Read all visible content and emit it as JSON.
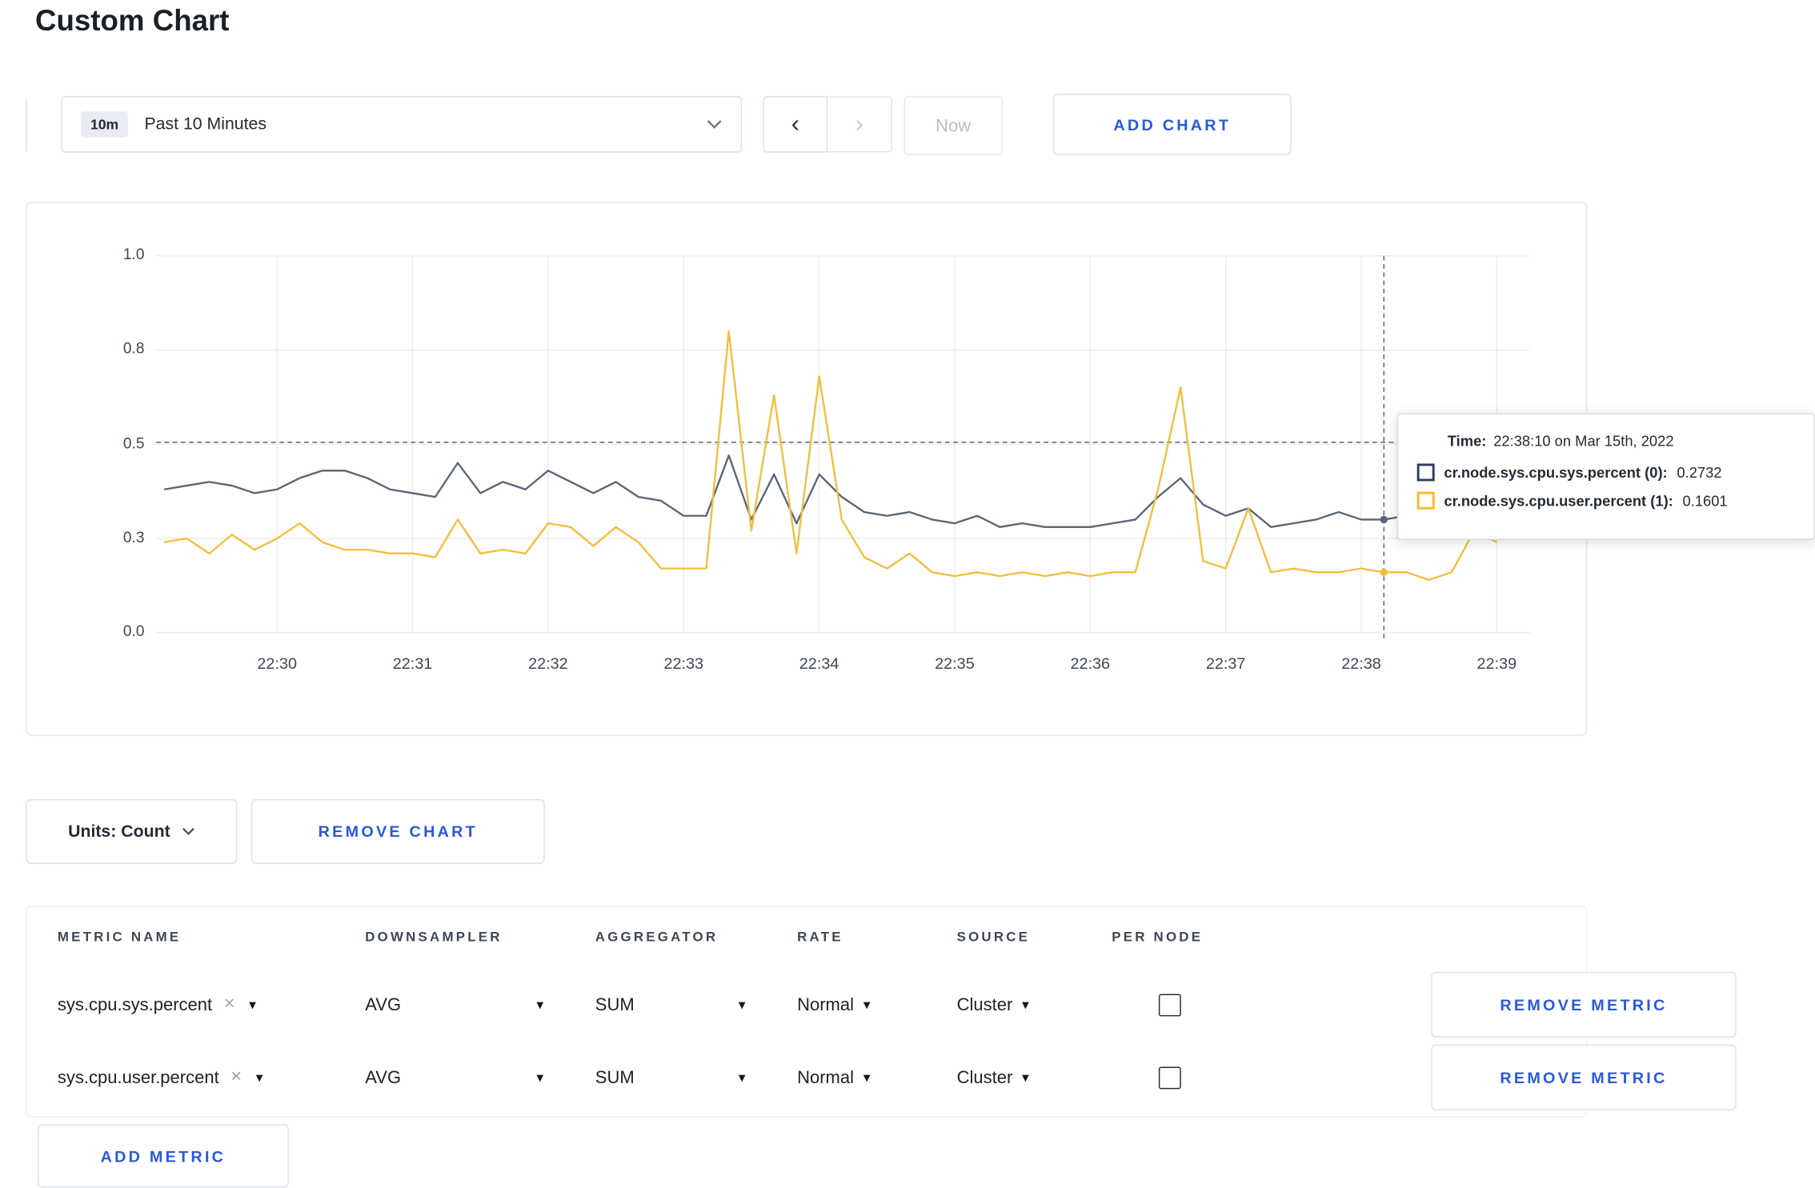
{
  "page": {
    "title": "Custom Chart"
  },
  "colors": {
    "accent_blue": "#2b59d8",
    "series_sys": "#5a6577",
    "series_user": "#f2be3c",
    "grid": "#ececec",
    "crosshair": "#5a6577"
  },
  "icons": {
    "chevron_left": "‹",
    "chevron_right": "›",
    "caret_down": "▾",
    "clear": "×"
  },
  "toolbar": {
    "range_badge": "10m",
    "range_label": "Past 10 Minutes",
    "now_label": "Now",
    "add_chart_label": "ADD CHART"
  },
  "chart": {
    "tooltip": {
      "time_label": "Time:",
      "time_value": "22:38:10 on Mar 15th, 2022",
      "series": [
        {
          "name": "cr.node.sys.cpu.sys.percent (0):",
          "value": "0.2732",
          "color": "#2c3e61"
        },
        {
          "name": "cr.node.sys.cpu.user.percent (1):",
          "value": "0.1601",
          "color": "#f5bd27"
        }
      ]
    }
  },
  "chart_data": {
    "type": "line",
    "title": "",
    "xlabel": "",
    "ylabel": "",
    "x_start_time": "22:29:10",
    "x_step_seconds": 10,
    "x_tick_labels": [
      "22:30",
      "22:31",
      "22:32",
      "22:33",
      "22:34",
      "22:35",
      "22:36",
      "22:37",
      "22:38",
      "22:39"
    ],
    "y_tick_labels": [
      "1.0",
      "0.8",
      "0.5",
      "0.3",
      "0.0"
    ],
    "y_tick_values": [
      1,
      0.75,
      0.5,
      0.25,
      0
    ],
    "ylim": [
      0,
      1
    ],
    "grid": true,
    "legend_position": "tooltip",
    "hover_index": 54,
    "crosshair_y": 0.505,
    "series": [
      {
        "name": "cr.node.sys.cpu.sys.percent",
        "color": "#5a6577",
        "values": [
          0.38,
          0.39,
          0.4,
          0.39,
          0.37,
          0.38,
          0.41,
          0.43,
          0.43,
          0.41,
          0.38,
          0.37,
          0.36,
          0.45,
          0.37,
          0.4,
          0.38,
          0.43,
          0.4,
          0.37,
          0.4,
          0.36,
          0.35,
          0.31,
          0.31,
          0.47,
          0.3,
          0.42,
          0.29,
          0.42,
          0.36,
          0.32,
          0.31,
          0.32,
          0.3,
          0.29,
          0.31,
          0.28,
          0.29,
          0.28,
          0.28,
          0.28,
          0.29,
          0.3,
          0.36,
          0.41,
          0.34,
          0.31,
          0.33,
          0.28,
          0.29,
          0.3,
          0.32,
          0.3,
          0.3,
          0.31,
          0.3,
          0.29,
          0.3,
          0.3
        ]
      },
      {
        "name": "cr.node.sys.cpu.user.percent",
        "color": "#f2be3c",
        "values": [
          0.24,
          0.25,
          0.21,
          0.26,
          0.22,
          0.25,
          0.29,
          0.24,
          0.22,
          0.22,
          0.21,
          0.21,
          0.2,
          0.3,
          0.21,
          0.22,
          0.21,
          0.29,
          0.28,
          0.23,
          0.28,
          0.24,
          0.17,
          0.17,
          0.17,
          0.8,
          0.27,
          0.63,
          0.21,
          0.68,
          0.3,
          0.2,
          0.17,
          0.21,
          0.16,
          0.15,
          0.16,
          0.15,
          0.16,
          0.15,
          0.16,
          0.15,
          0.16,
          0.16,
          0.38,
          0.65,
          0.19,
          0.17,
          0.33,
          0.16,
          0.17,
          0.16,
          0.16,
          0.17,
          0.16,
          0.16,
          0.14,
          0.16,
          0.27,
          0.24
        ]
      }
    ]
  },
  "footer_controls": {
    "units_label": "Units: Count",
    "remove_chart_label": "REMOVE CHART",
    "add_metric_label": "ADD METRIC"
  },
  "metrics_table": {
    "headers": [
      "METRIC NAME",
      "DOWNSAMPLER",
      "AGGREGATOR",
      "RATE",
      "SOURCE",
      "PER NODE"
    ],
    "rows": [
      {
        "metric": "sys.cpu.sys.percent",
        "downsampler": "AVG",
        "aggregator": "SUM",
        "rate": "Normal",
        "source": "Cluster",
        "per_node": false,
        "remove_label": "REMOVE METRIC"
      },
      {
        "metric": "sys.cpu.user.percent",
        "downsampler": "AVG",
        "aggregator": "SUM",
        "rate": "Normal",
        "source": "Cluster",
        "per_node": false,
        "remove_label": "REMOVE METRIC"
      }
    ]
  }
}
